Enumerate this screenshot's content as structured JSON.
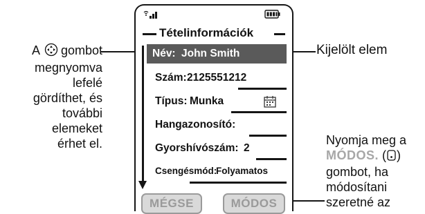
{
  "left_callout": {
    "lines": [
      "A",
      "gombot",
      "megnyomva",
      "lefelé",
      "gördíthet, és",
      "további",
      "elemeket",
      "érhet el."
    ]
  },
  "right_top_callout": "Kijelölt elem",
  "right_bottom_callout": {
    "line1": "Nyomja meg a",
    "accent": "MÓDOS.",
    "line3": "gombot, ha",
    "line4": "módosítani",
    "line5": "szeretné az"
  },
  "phone": {
    "title": "Tételinformációk",
    "rows": [
      {
        "label": "Név:",
        "value": "John Smith",
        "selected": true
      },
      {
        "label": "Szám:",
        "value": "2125551212",
        "selected": false
      },
      {
        "label": "Típus:",
        "value": "Munka",
        "selected": false,
        "icon": "calendar-icon"
      },
      {
        "label": "Hangazonosító:",
        "value": "",
        "selected": false
      },
      {
        "label": "Gyorshívószám:",
        "value": "2",
        "selected": false
      },
      {
        "label": "Csengésmód:",
        "value": "Folyamatos",
        "selected": false
      }
    ],
    "softkeys": {
      "left": "MÉGSE",
      "right": "MÓDOS"
    },
    "status_icons": [
      "signal-icon",
      "battery-icon"
    ]
  },
  "colors": {
    "outline": "#151515",
    "selected_row": "#5a5a5a",
    "softkey_text": "#9a9a9a",
    "accent_text": "#a7a7a7"
  }
}
